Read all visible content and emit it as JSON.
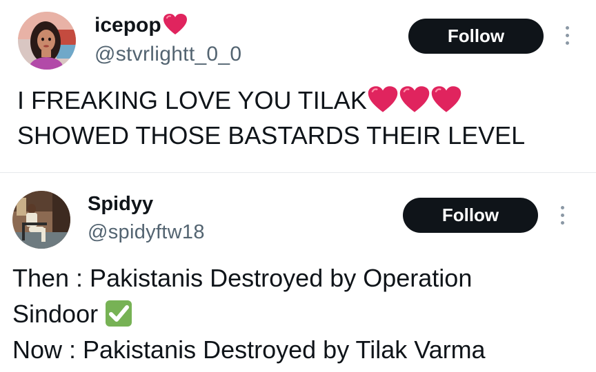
{
  "tweets": [
    {
      "display_name": "icepop",
      "name_emoji": "red-heart-icon",
      "handle": "@stvrlightt_0_0",
      "follow_label": "Follow",
      "text_line1": "I FREAKING LOVE YOU TILAK",
      "text_line1_emoji": [
        "red-heart-icon",
        "red-heart-icon",
        "red-heart-icon"
      ],
      "text_line2": "SHOWED THOSE BASTARDS THEIR LEVEL"
    },
    {
      "display_name": "Spidyy",
      "handle": "@spidyftw18",
      "follow_label": "Follow",
      "text_line1": "Then : Pakistanis Destroyed by Operation",
      "text_line2": "Sindoor",
      "text_line2_emoji": "check-mark-button-icon",
      "text_line3": "Now : Pakistanis Destroyed by Tilak Varma"
    }
  ],
  "colors": {
    "follow_bg": "#0f1419",
    "follow_text": "#ffffff",
    "handle": "#536471",
    "heart": "#e0245e",
    "check": "#77b255"
  }
}
